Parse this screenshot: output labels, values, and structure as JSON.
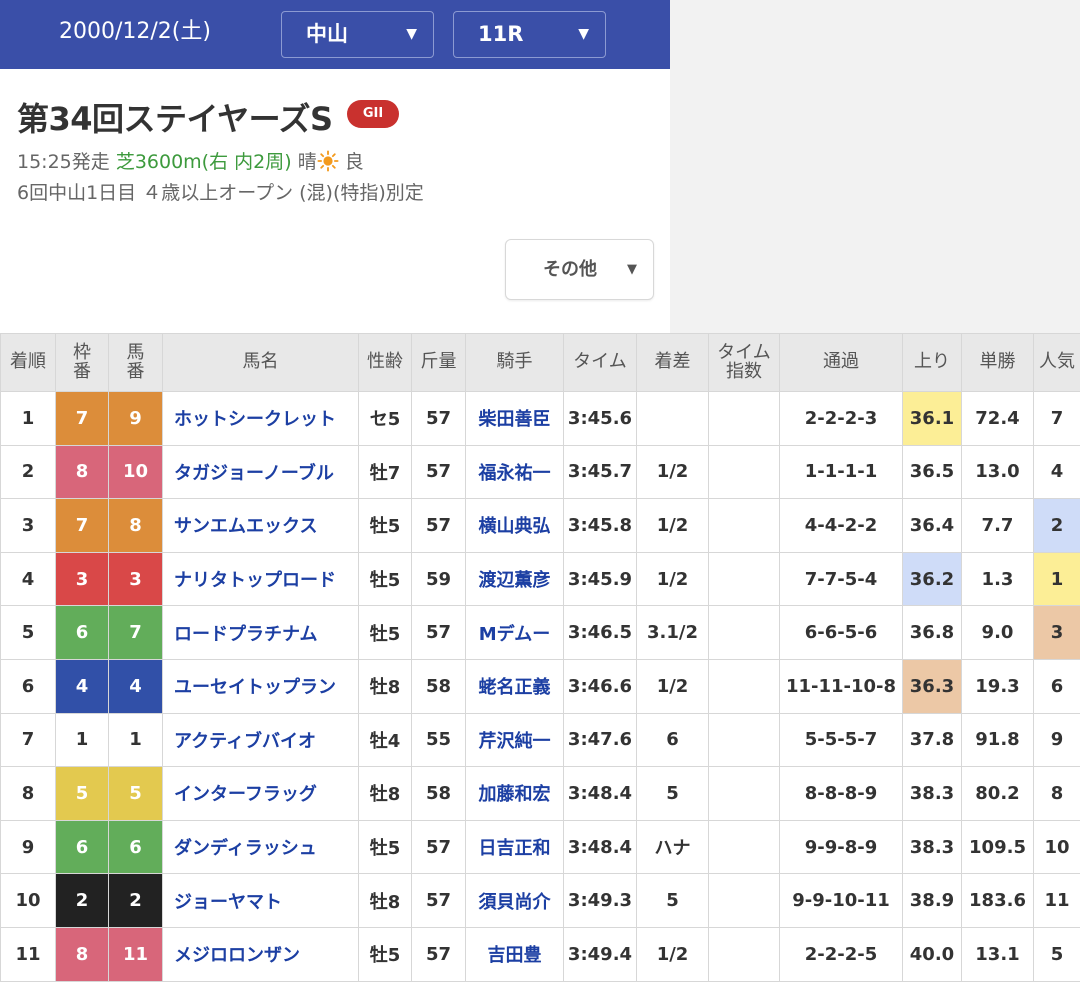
{
  "header": {
    "date": "2000/12/2(土)",
    "venue": "中山",
    "race_no": "11R"
  },
  "race": {
    "title": "第34回ステイヤーズS",
    "grade": "GII",
    "start_time": "15:25発走",
    "course": "芝3600m(右 内2周)",
    "weather": "晴",
    "weather_icon": "sun-icon",
    "track_condition": "良",
    "meta": "6回中山1日目 ４歳以上オープン (混)(特指)別定"
  },
  "other_button": {
    "label": "その他"
  },
  "table": {
    "headers": {
      "rank": "着順",
      "bracket": [
        "枠",
        "番"
      ],
      "number": [
        "馬",
        "番"
      ],
      "horse": "馬名",
      "sex_age": "性齢",
      "weight": "斤量",
      "jockey": "騎手",
      "time": "タイム",
      "margin": "着差",
      "time_index": [
        "タイム",
        "指数"
      ],
      "passing": "通過",
      "last3f": "上り",
      "odds": "単勝",
      "popularity": "人気"
    },
    "colors": {
      "bracket": {
        "1": {
          "bg": "#ffffff",
          "fg": "#333333"
        },
        "2": {
          "bg": "#222222",
          "fg": "#ffffff"
        },
        "3": {
          "bg": "#d94848",
          "fg": "#ffffff"
        },
        "4": {
          "bg": "#3150a8",
          "fg": "#ffffff"
        },
        "5": {
          "bg": "#e3c94f",
          "fg": "#ffffff"
        },
        "6": {
          "bg": "#62ad5a",
          "fg": "#ffffff"
        },
        "7": {
          "bg": "#dc8d3a",
          "fg": "#ffffff"
        },
        "8": {
          "bg": "#d8667a",
          "fg": "#ffffff"
        }
      },
      "rank_highlight": {
        "1": "#fcee96",
        "2": "#cfdcf8",
        "3": "#ecc8a6"
      }
    },
    "rows": [
      {
        "rank": "1",
        "bracket": "7",
        "number": "9",
        "horse": "ホットシークレット",
        "sex_age": "セ5",
        "weight": "57",
        "jockey": "柴田善臣",
        "time": "3:45.6",
        "margin": "",
        "time_index": "",
        "passing": "2-2-2-3",
        "last3f": "36.1",
        "last3f_rank": 1,
        "odds": "72.4",
        "popularity": "7"
      },
      {
        "rank": "2",
        "bracket": "8",
        "number": "10",
        "horse": "タガジョーノーブル",
        "sex_age": "牡7",
        "weight": "57",
        "jockey": "福永祐一",
        "time": "3:45.7",
        "margin": "1/2",
        "time_index": "",
        "passing": "1-1-1-1",
        "last3f": "36.5",
        "odds": "13.0",
        "popularity": "4"
      },
      {
        "rank": "3",
        "bracket": "7",
        "number": "8",
        "horse": "サンエムエックス",
        "sex_age": "牡5",
        "weight": "57",
        "jockey": "横山典弘",
        "time": "3:45.8",
        "margin": "1/2",
        "time_index": "",
        "passing": "4-4-2-2",
        "last3f": "36.4",
        "odds": "7.7",
        "popularity": "2"
      },
      {
        "rank": "4",
        "bracket": "3",
        "number": "3",
        "horse": "ナリタトップロード",
        "sex_age": "牡5",
        "weight": "59",
        "jockey": "渡辺薫彦",
        "time": "3:45.9",
        "margin": "1/2",
        "time_index": "",
        "passing": "7-7-5-4",
        "last3f": "36.2",
        "last3f_rank": 2,
        "odds": "1.3",
        "popularity": "1"
      },
      {
        "rank": "5",
        "bracket": "6",
        "number": "7",
        "horse": "ロードプラチナム",
        "sex_age": "牡5",
        "weight": "57",
        "jockey": "Mデムー",
        "time": "3:46.5",
        "margin": "3.1/2",
        "time_index": "",
        "passing": "6-6-5-6",
        "last3f": "36.8",
        "odds": "9.0",
        "popularity": "3"
      },
      {
        "rank": "6",
        "bracket": "4",
        "number": "4",
        "horse": "ユーセイトップラン",
        "sex_age": "牡8",
        "weight": "58",
        "jockey": "蛯名正義",
        "time": "3:46.6",
        "margin": "1/2",
        "time_index": "",
        "passing": "11-11-10-8",
        "last3f": "36.3",
        "last3f_rank": 3,
        "odds": "19.3",
        "popularity": "6"
      },
      {
        "rank": "7",
        "bracket": "1",
        "number": "1",
        "horse": "アクティブバイオ",
        "sex_age": "牡4",
        "weight": "55",
        "jockey": "芹沢純一",
        "time": "3:47.6",
        "margin": "6",
        "time_index": "",
        "passing": "5-5-5-7",
        "last3f": "37.8",
        "odds": "91.8",
        "popularity": "9"
      },
      {
        "rank": "8",
        "bracket": "5",
        "number": "5",
        "horse": "インターフラッグ",
        "sex_age": "牡8",
        "weight": "58",
        "jockey": "加藤和宏",
        "time": "3:48.4",
        "margin": "5",
        "time_index": "",
        "passing": "8-8-8-9",
        "last3f": "38.3",
        "odds": "80.2",
        "popularity": "8"
      },
      {
        "rank": "9",
        "bracket": "6",
        "number": "6",
        "horse": "ダンディラッシュ",
        "sex_age": "牡5",
        "weight": "57",
        "jockey": "日吉正和",
        "time": "3:48.4",
        "margin": "ハナ",
        "time_index": "",
        "passing": "9-9-8-9",
        "last3f": "38.3",
        "odds": "109.5",
        "popularity": "10"
      },
      {
        "rank": "10",
        "bracket": "2",
        "number": "2",
        "horse": "ジョーヤマト",
        "sex_age": "牡8",
        "weight": "57",
        "jockey": "須貝尚介",
        "time": "3:49.3",
        "margin": "5",
        "time_index": "",
        "passing": "9-9-10-11",
        "last3f": "38.9",
        "odds": "183.6",
        "popularity": "11"
      },
      {
        "rank": "11",
        "bracket": "8",
        "number": "11",
        "horse": "メジロロンザン",
        "sex_age": "牡5",
        "weight": "57",
        "jockey": "吉田豊",
        "time": "3:49.4",
        "margin": "1/2",
        "time_index": "",
        "passing": "2-2-2-5",
        "last3f": "40.0",
        "odds": "13.1",
        "popularity": "5"
      }
    ]
  }
}
